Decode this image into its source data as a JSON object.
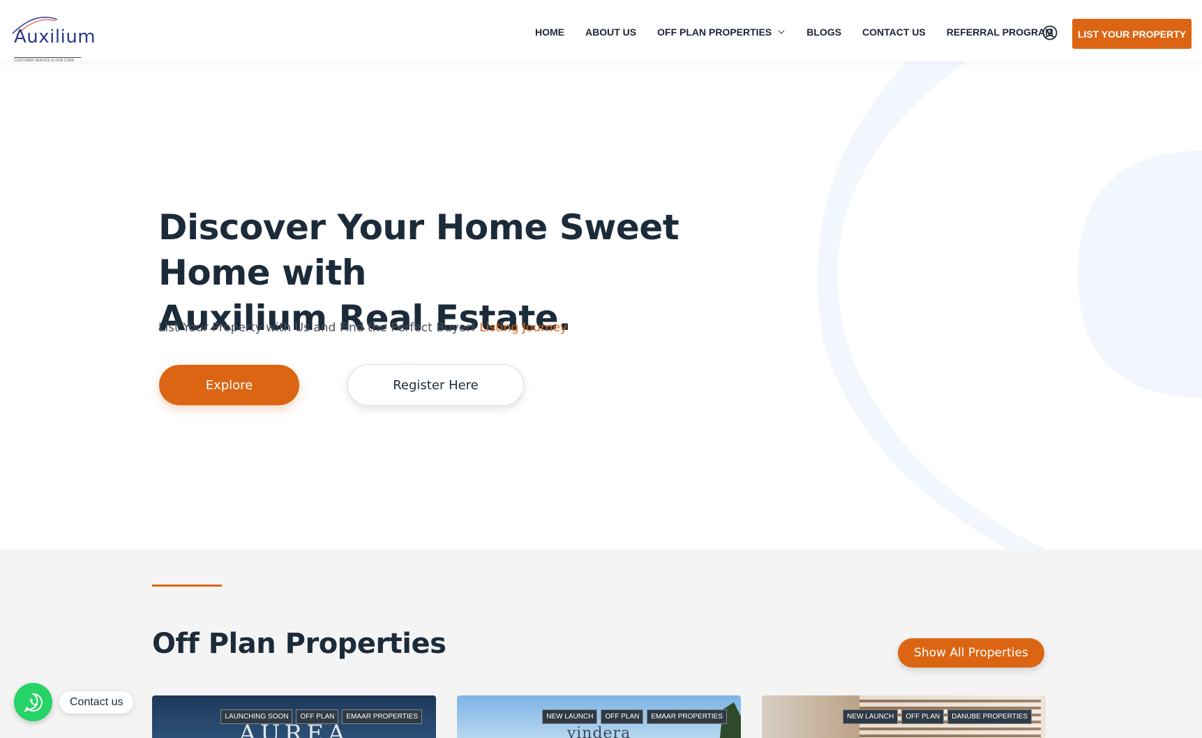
{
  "header": {
    "logo_text": "Auxilium",
    "logo_tagline": "CUSTOMER SERVICE IS OUR CORE",
    "nav": [
      {
        "label": "HOME"
      },
      {
        "label": "ABOUT US"
      },
      {
        "label": "OFF PLAN PROPERTIES"
      },
      {
        "label": "BLOGS"
      },
      {
        "label": "CONTACT US"
      },
      {
        "label": "REFERRAL PROGRAM"
      }
    ],
    "cta_label": "LIST YOUR PROPERTY"
  },
  "hero": {
    "title_line1": "Discover Your Home Sweet Home with",
    "title_line2": "Auxilium Real Estate.",
    "subtitle": "List Your Property with Us and Find the Perfect Buyer!",
    "subtitle_link": "Listing Journey",
    "explore_label": "Explore",
    "register_label": "Register Here"
  },
  "properties": {
    "title": "Off Plan Properties",
    "show_all_label": "Show All Properties",
    "cards": [
      {
        "tags": [
          "LAUNCHING SOON",
          "OFF PLAN",
          "EMAAR PROPERTIES"
        ],
        "image_text": "AUREA"
      },
      {
        "tags": [
          "NEW LAUNCH",
          "OFF PLAN",
          "EMAAR PROPERTIES"
        ],
        "image_text": "vindera"
      },
      {
        "tags": [
          "NEW LAUNCH",
          "OFF PLAN",
          "DANUBE PROPERTIES"
        ],
        "image_text": ""
      }
    ]
  },
  "whatsapp": {
    "label": "Contact us"
  },
  "colors": {
    "accent": "#dc6513",
    "heading": "#1c2b3a",
    "section_bg": "#f4f4f4",
    "whatsapp": "#25d366"
  }
}
